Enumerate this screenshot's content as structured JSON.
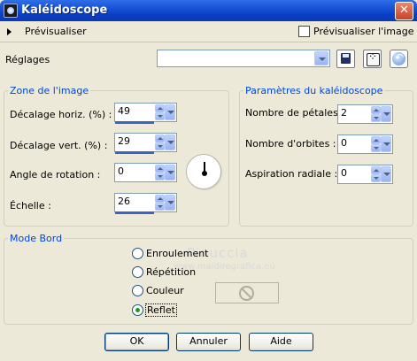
{
  "window": {
    "title": "Kaléidoscope"
  },
  "preview": {
    "label": "Prévisualiser",
    "checkbox_label": "Prévisualiser l'image",
    "checked": false
  },
  "settings": {
    "label": "Réglages",
    "value": ""
  },
  "zone": {
    "legend": "Zone de l'image",
    "fields": [
      {
        "label": "Décalage horiz. (%) :",
        "value": "49"
      },
      {
        "label": "Décalage vert. (%) :",
        "value": "29"
      },
      {
        "label": "Angle de rotation :",
        "value": "0"
      },
      {
        "label": "Échelle :",
        "value": "26"
      }
    ]
  },
  "params": {
    "legend": "Paramètres du kaléidoscope",
    "fields": [
      {
        "label": "Nombre de pétales :",
        "value": "2"
      },
      {
        "label": "Nombre d'orbites :",
        "value": "0"
      },
      {
        "label": "Aspiration radiale :",
        "value": "0"
      }
    ]
  },
  "mode": {
    "legend": "Mode Bord",
    "options": [
      "Enroulement",
      "Répétition",
      "Couleur",
      "Reflet"
    ],
    "selected": "Reflet"
  },
  "watermark": {
    "main": "Pinuccia",
    "sub": "www.maidiregrafica.eu"
  },
  "buttons": {
    "ok": "OK",
    "cancel": "Annuler",
    "help": "Aide"
  },
  "colors": {
    "accent": "#0046d5",
    "title_bar": "#0a3ab4"
  },
  "icons": {
    "settings_tools": [
      "save-icon",
      "randomize-dice-icon",
      "reset-icon"
    ],
    "edge_color": "no-color-icon"
  }
}
